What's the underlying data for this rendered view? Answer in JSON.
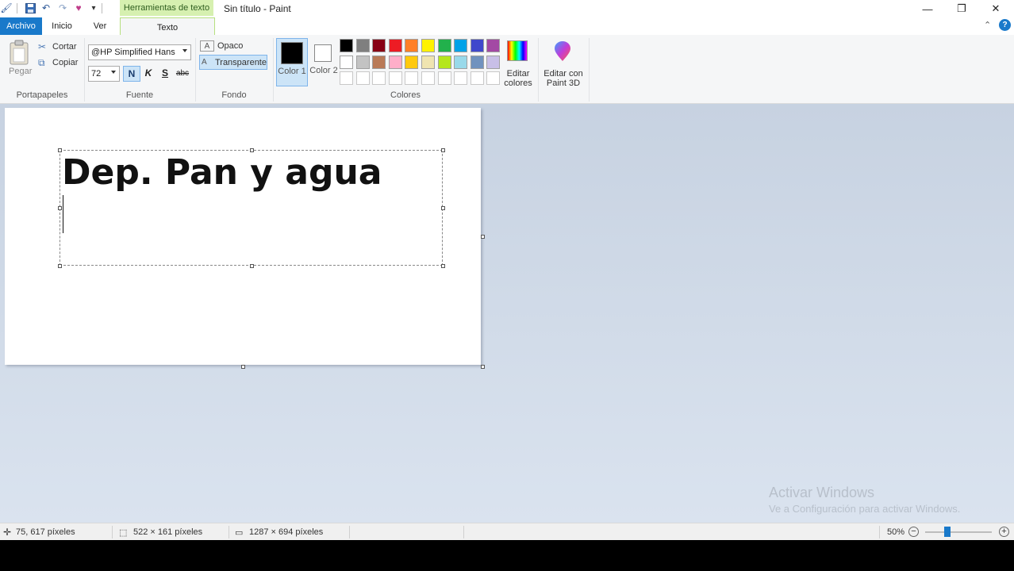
{
  "window": {
    "title": "Sin título - Paint",
    "context_tab": "Herramientas de texto",
    "minimize": "—",
    "restore": "❐",
    "close": "✕"
  },
  "tabs": {
    "archivo": "Archivo",
    "inicio": "Inicio",
    "ver": "Ver",
    "texto": "Texto"
  },
  "ribbon": {
    "portapapeles": {
      "group": "Portapapeles",
      "pegar": "Pegar",
      "cortar": "Cortar",
      "copiar": "Copiar"
    },
    "fuente": {
      "group": "Fuente",
      "font_name": "@HP Simplified Hans",
      "font_size": "72",
      "bold": "N",
      "italic": "K",
      "underline": "S",
      "strike": "abc"
    },
    "fondo": {
      "group": "Fondo",
      "opaco": "Opaco",
      "transparente": "Transparente"
    },
    "colores": {
      "group": "Colores",
      "color1": "Color 1",
      "color2": "Color 2",
      "color1_value": "#000000",
      "color2_value": "#ffffff",
      "palette_row1": [
        "#000000",
        "#7f7f7f",
        "#880015",
        "#ed1c24",
        "#ff7f27",
        "#fff200",
        "#22b14c",
        "#00a2e8",
        "#3f48cc",
        "#a349a4"
      ],
      "palette_row2": [
        "#ffffff",
        "#c3c3c3",
        "#b97a57",
        "#ffaec9",
        "#ffc90e",
        "#efe4b0",
        "#b5e61d",
        "#99d9ea",
        "#7092be",
        "#c8bfe7"
      ],
      "palette_row3": [
        "#ffffff",
        "#ffffff",
        "#ffffff",
        "#ffffff",
        "#ffffff",
        "#ffffff",
        "#ffffff",
        "#ffffff",
        "#ffffff",
        "#ffffff"
      ],
      "editar_colores": "Editar colores"
    },
    "paint3d": {
      "label": "Editar con Paint 3D"
    }
  },
  "canvas": {
    "text": "Dep. Pan y agua"
  },
  "watermark": {
    "line1": "Activar Windows",
    "line2": "Ve a Configuración para activar Windows."
  },
  "status": {
    "cursor_pos": "75, 617 píxeles",
    "selection_size": "522 × 161 píxeles",
    "image_size": "1287 × 694 píxeles",
    "zoom": "50%",
    "zoom_level": 0.5
  }
}
